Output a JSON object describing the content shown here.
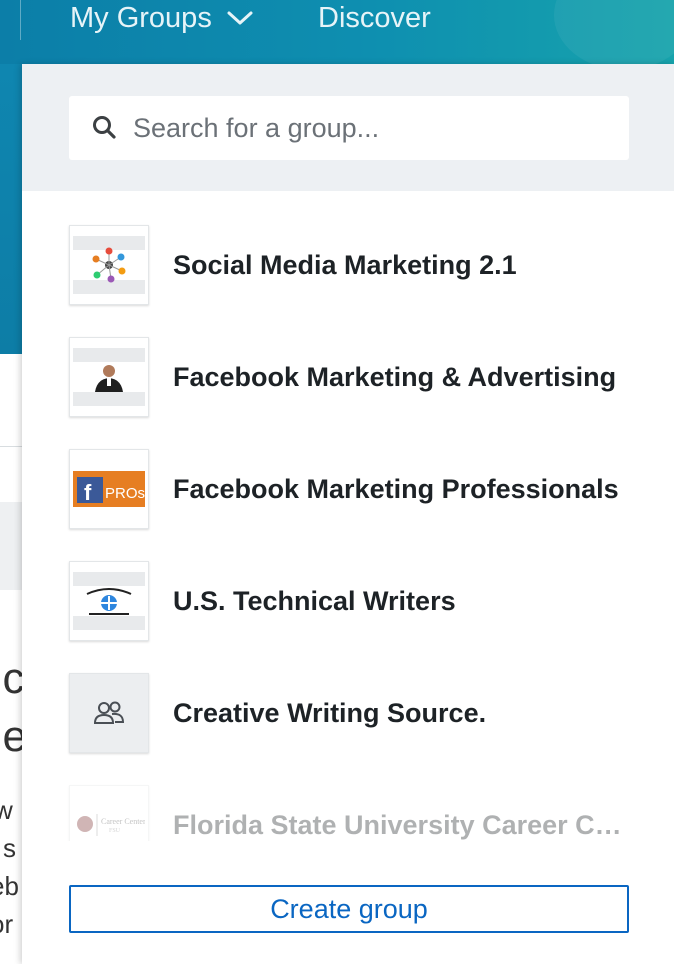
{
  "nav": {
    "my_groups_label": "My Groups",
    "discover_label": "Discover"
  },
  "search": {
    "placeholder": "Search for a group..."
  },
  "groups": [
    {
      "name": "Social Media Marketing 2.1",
      "icon": "social-network-logo"
    },
    {
      "name": "Facebook Marketing & Advertising",
      "icon": "person-photo"
    },
    {
      "name": "Facebook Marketing Professionals",
      "icon": "fb-pros-logo"
    },
    {
      "name": "U.S. Technical Writers",
      "icon": "us-tech-writers-logo"
    },
    {
      "name": "Creative Writing Source.",
      "icon": "group-placeholder-icon"
    },
    {
      "name": "Florida State University Career Center",
      "icon": "career-center-logo"
    }
  ],
  "create_group_label": "Create group",
  "background_fragments": {
    "big1": "nc",
    "big2": "ne",
    "small": [
      "w",
      "l s",
      "eb",
      "or"
    ]
  },
  "colors": {
    "topbar": "#0e8fb0",
    "accent": "#0a66c2",
    "search_bg": "#edf0f3",
    "text_dark": "#1d2226"
  }
}
